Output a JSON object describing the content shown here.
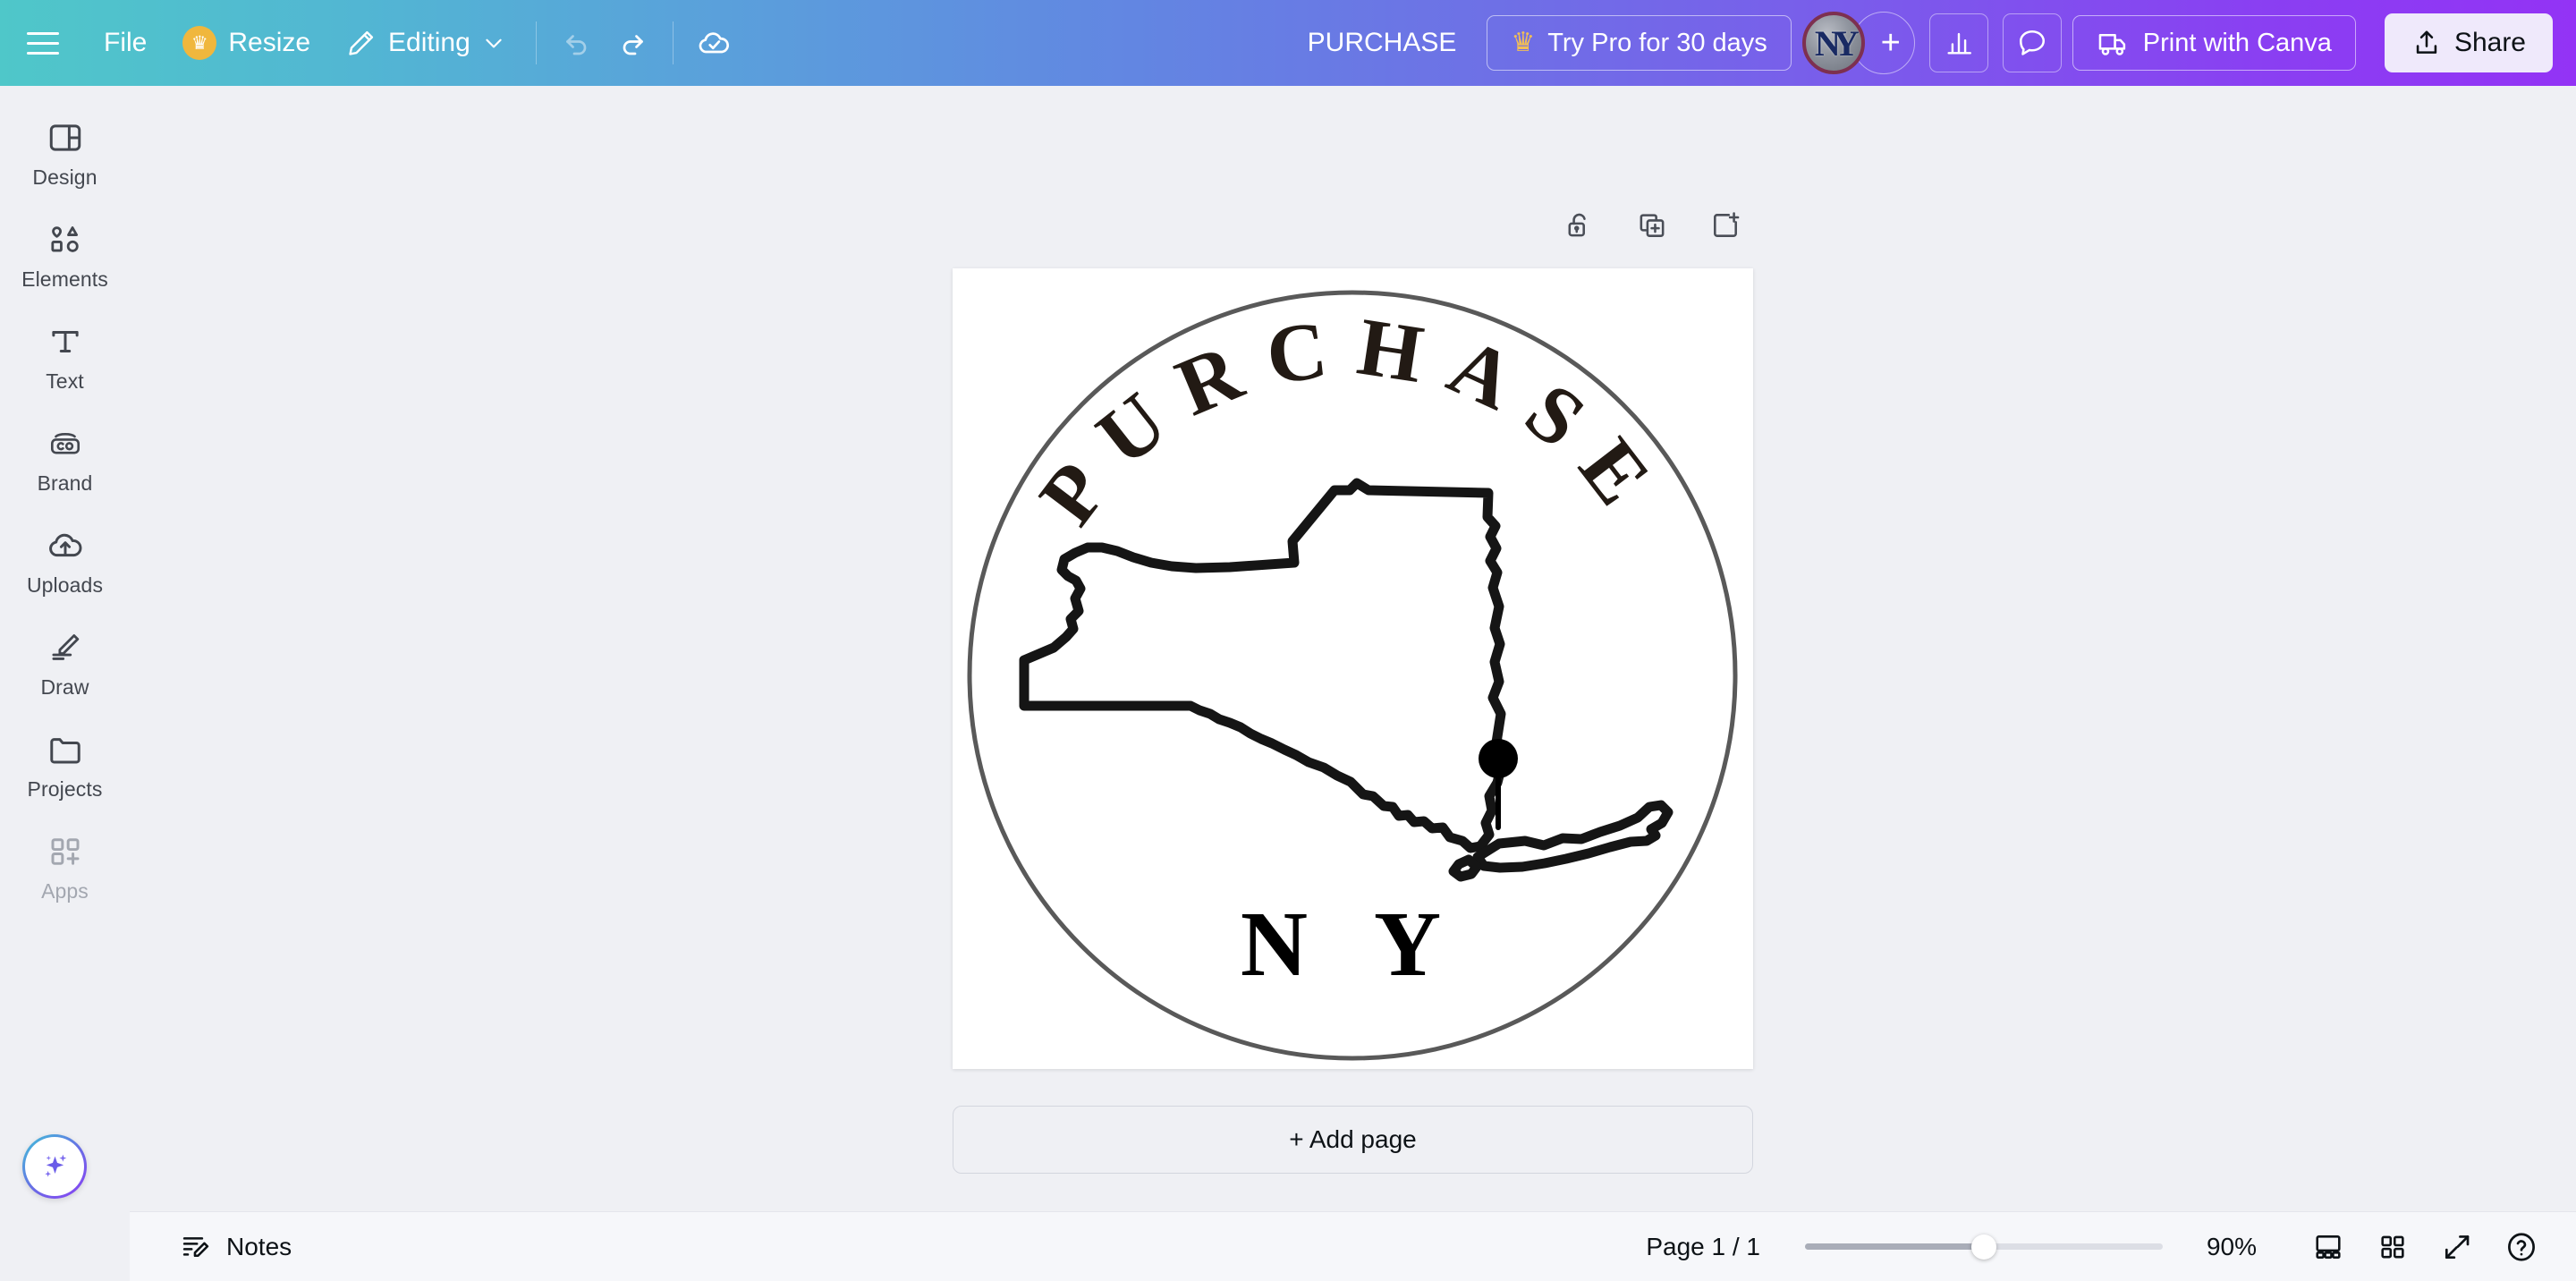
{
  "topbar": {
    "menu_icon": "hamburger-icon",
    "file_label": "File",
    "resize_label": "Resize",
    "resize_crown_icon": "crown-icon",
    "editing_label": "Editing",
    "editing_pencil_icon": "pencil-icon",
    "editing_chevron_icon": "chevron-down-icon",
    "undo_icon": "undo-icon",
    "redo_icon": "redo-icon",
    "save_status_icon": "cloud-check-icon",
    "doc_title": "PURCHASE",
    "try_pro_label": "Try Pro for 30 days",
    "try_pro_crown_icon": "crown-icon",
    "avatar_name": "NY",
    "add_collaborator_icon": "plus-icon",
    "stats_icon": "bar-chart-icon",
    "comment_icon": "comment-bubble-icon",
    "print_label": "Print with Canva",
    "print_icon": "delivery-truck-icon",
    "share_label": "Share",
    "share_icon": "upload-arrow-icon",
    "gradient_start": "#4fc7c9",
    "gradient_mid": "#6e70e6",
    "gradient_end": "#9333f5"
  },
  "sidebar": {
    "items": [
      {
        "label": "Design",
        "icon": "design-panel-icon",
        "muted": false
      },
      {
        "label": "Elements",
        "icon": "shapes-icon",
        "muted": false
      },
      {
        "label": "Text",
        "icon": "text-t-icon",
        "muted": false
      },
      {
        "label": "Brand",
        "icon": "brand-co-icon",
        "muted": false
      },
      {
        "label": "Uploads",
        "icon": "cloud-upload-icon",
        "muted": false
      },
      {
        "label": "Draw",
        "icon": "marker-pen-icon",
        "muted": false
      },
      {
        "label": "Projects",
        "icon": "folder-icon",
        "muted": false
      },
      {
        "label": "Apps",
        "icon": "apps-grid-plus-icon",
        "muted": true
      }
    ],
    "magic_button_icon": "magic-sparkle-icon"
  },
  "page_tools": [
    {
      "name": "unlock-page",
      "icon": "open-padlock-icon"
    },
    {
      "name": "duplicate-page",
      "icon": "duplicate-page-icon"
    },
    {
      "name": "add-page",
      "icon": "add-page-icon"
    }
  ],
  "canvas": {
    "add_page_label": "+ Add page",
    "design": {
      "arc_text": "PURCHASE",
      "bottom_text": "N Y",
      "shape": "new-york-state-outline",
      "marker": "map-pin-marker",
      "ring_color": "#595959",
      "ink_color": "#221a14",
      "background": "#ffffff"
    }
  },
  "bottombar": {
    "notes_label": "Notes",
    "notes_icon": "notes-pencil-icon",
    "page_indicator": "Page 1 / 1",
    "zoom_value": "90%",
    "zoom_slider_percent": 50,
    "presenter_icon": "presenter-view-icon",
    "grid_icon": "grid-view-icon",
    "fullscreen_icon": "fullscreen-expand-icon",
    "help_icon": "help-question-icon"
  }
}
